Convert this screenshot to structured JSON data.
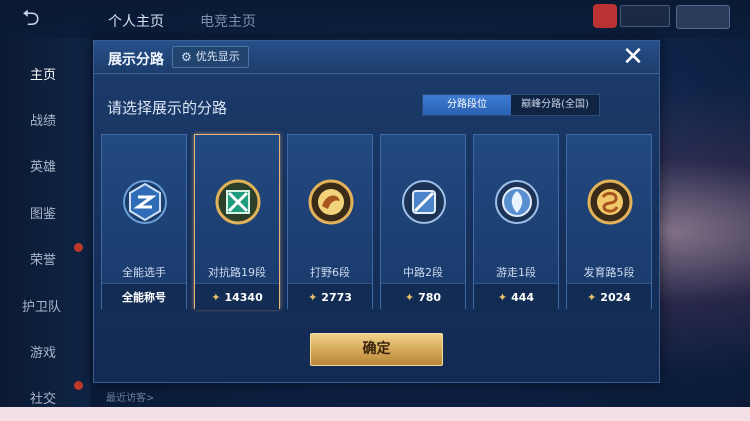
{
  "background": {
    "top_tabs": [
      "个人主页",
      "电竞主页"
    ],
    "sidebar": [
      "主页",
      "战绩",
      "英雄",
      "图鉴",
      "荣誉",
      "护卫队",
      "游戏",
      "社交"
    ],
    "sidebar_active": "主页",
    "footer_hint": "最近访客>"
  },
  "modal": {
    "title": "展示分路",
    "priority_label": "优先显示",
    "close_icon": "close-icon",
    "subtitle": "请选择展示的分路",
    "tabs": [
      "分路段位",
      "巅峰分路(全国)"
    ],
    "active_tab": "分路段位",
    "cards": [
      {
        "lane": "全能选手",
        "value": "全能称号",
        "selected": false,
        "icon": "all-round-emblem"
      },
      {
        "lane": "对抗路19段",
        "value": "14340",
        "selected": true,
        "icon": "clash-lane-emblem"
      },
      {
        "lane": "打野6段",
        "value": "2773",
        "selected": false,
        "icon": "jungle-emblem"
      },
      {
        "lane": "中路2段",
        "value": "780",
        "selected": false,
        "icon": "mid-lane-emblem"
      },
      {
        "lane": "游走1段",
        "value": "444",
        "selected": false,
        "icon": "roam-emblem"
      },
      {
        "lane": "发育路5段",
        "value": "2024",
        "selected": false,
        "icon": "farm-lane-emblem"
      }
    ],
    "confirm_label": "确定"
  },
  "colors": {
    "accent_gold": "#e8c46a",
    "tab_active": "#2a61b3",
    "selected_border": "#e7b47a"
  }
}
